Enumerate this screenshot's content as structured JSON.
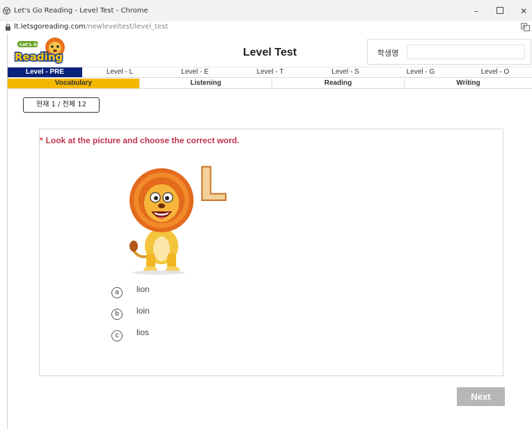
{
  "browser": {
    "window_title": "Let's Go Reading - Level Test - Chrome",
    "url_host": "lt.letsgoreading.com",
    "url_path": "/newleveltest/level_test"
  },
  "header": {
    "logo_text_top": "Let's Go",
    "logo_text_main": "Reading",
    "page_title": "Level Test",
    "student_label": "학생명",
    "student_name_value": ""
  },
  "levels": [
    "Level - PRE",
    "Level - L",
    "Level - E",
    "Level - T",
    "Level - S",
    "Level - G",
    "Level - O"
  ],
  "active_level": "Level - PRE",
  "sections": [
    "Vocabulary",
    "Listening",
    "Reading",
    "Writing"
  ],
  "active_section": "Vocabulary",
  "progress_text": "현재 1 / 전체 12",
  "question": {
    "prompt_marker": "*",
    "prompt": "Look at the picture and choose the correct word.",
    "picture_letter": "L",
    "options": [
      {
        "marker": "a",
        "text": "lion"
      },
      {
        "marker": "b",
        "text": "loin"
      },
      {
        "marker": "c",
        "text": "lios"
      }
    ]
  },
  "next_label": "Next",
  "colors": {
    "level_active": "#0a237a",
    "section_active": "#f5b800",
    "prompt": "#c0354d",
    "next_disabled": "#b7b7b7"
  }
}
